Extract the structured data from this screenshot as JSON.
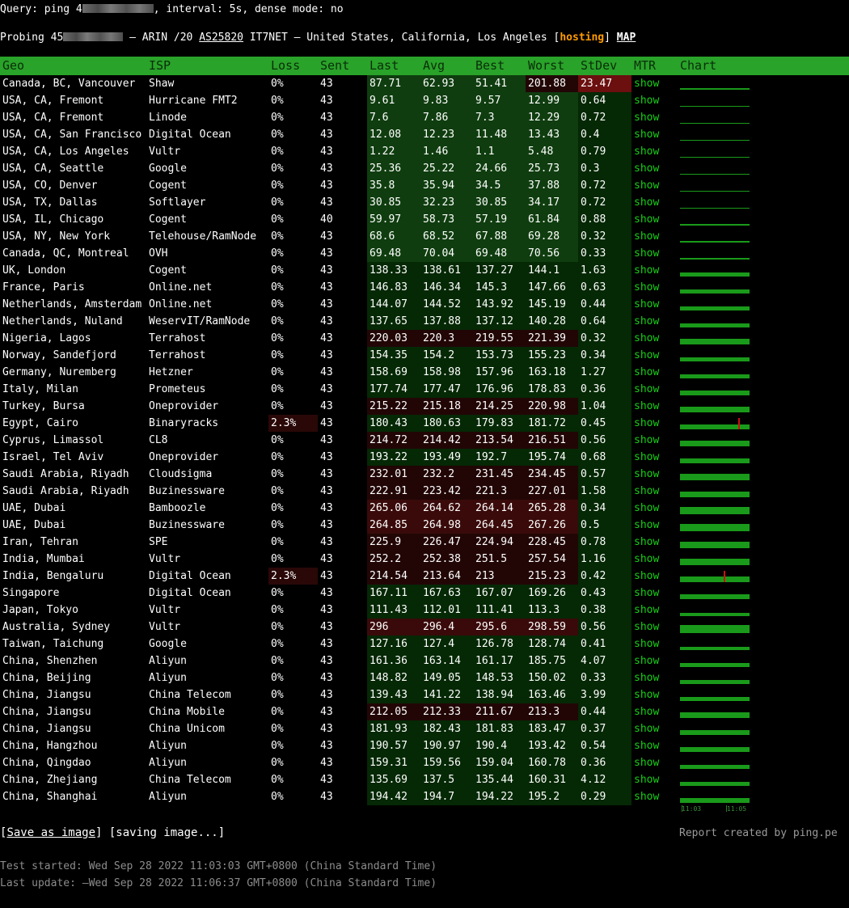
{
  "query": {
    "prefix": "Query: ping 4",
    "suffix": ", interval: 5s, dense mode: no"
  },
  "probing": {
    "prefix": "Probing 45",
    "rest_before": " — ARIN /20 ",
    "asn": "AS25820",
    "isp_loc": " IT7NET — United States, California, Los Angeles [",
    "hosting": "hosting",
    "close": "] ",
    "map": "MAP"
  },
  "table": {
    "headers": [
      "Geo",
      "ISP",
      "Loss",
      "Sent",
      "Last",
      "Avg",
      "Best",
      "Worst",
      "StDev",
      "MTR",
      "Chart"
    ],
    "mtr_label": "show",
    "rows": [
      [
        "Canada, BC, Vancouver",
        "Shaw",
        "0%",
        "43",
        "87.71",
        "62.93",
        "51.41",
        "201.88",
        "23.47"
      ],
      [
        "USA, CA, Fremont",
        "Hurricane FMT2",
        "0%",
        "43",
        "9.61",
        "9.83",
        "9.57",
        "12.99",
        "0.64"
      ],
      [
        "USA, CA, Fremont",
        "Linode",
        "0%",
        "43",
        "7.6",
        "7.86",
        "7.3",
        "12.29",
        "0.72"
      ],
      [
        "USA, CA, San Francisco",
        "Digital Ocean",
        "0%",
        "43",
        "12.08",
        "12.23",
        "11.48",
        "13.43",
        "0.4"
      ],
      [
        "USA, CA, Los Angeles",
        "Vultr",
        "0%",
        "43",
        "1.22",
        "1.46",
        "1.1",
        "5.48",
        "0.79"
      ],
      [
        "USA, CA, Seattle",
        "Google",
        "0%",
        "43",
        "25.36",
        "25.22",
        "24.66",
        "25.73",
        "0.3"
      ],
      [
        "USA, CO, Denver",
        "Cogent",
        "0%",
        "43",
        "35.8",
        "35.94",
        "34.5",
        "37.88",
        "0.72"
      ],
      [
        "USA, TX, Dallas",
        "Softlayer",
        "0%",
        "43",
        "30.85",
        "32.23",
        "30.85",
        "34.17",
        "0.72"
      ],
      [
        "USA, IL, Chicago",
        "Cogent",
        "0%",
        "40",
        "59.97",
        "58.73",
        "57.19",
        "61.84",
        "0.88"
      ],
      [
        "USA, NY, New York",
        "Telehouse/RamNode",
        "0%",
        "43",
        "68.6",
        "68.52",
        "67.88",
        "69.28",
        "0.32"
      ],
      [
        "Canada, QC, Montreal",
        "OVH",
        "0%",
        "43",
        "69.48",
        "70.04",
        "69.48",
        "70.56",
        "0.33"
      ],
      [
        "UK, London",
        "Cogent",
        "0%",
        "43",
        "138.33",
        "138.61",
        "137.27",
        "144.1",
        "1.63"
      ],
      [
        "France, Paris",
        "Online.net",
        "0%",
        "43",
        "146.83",
        "146.34",
        "145.3",
        "147.66",
        "0.63"
      ],
      [
        "Netherlands, Amsterdam",
        "Online.net",
        "0%",
        "43",
        "144.07",
        "144.52",
        "143.92",
        "145.19",
        "0.44"
      ],
      [
        "Netherlands, Nuland",
        "WeservIT/RamNode",
        "0%",
        "43",
        "137.65",
        "137.88",
        "137.12",
        "140.28",
        "0.64"
      ],
      [
        "Nigeria, Lagos",
        "Terrahost",
        "0%",
        "43",
        "220.03",
        "220.3",
        "219.55",
        "221.39",
        "0.32"
      ],
      [
        "Norway, Sandefjord",
        "Terrahost",
        "0%",
        "43",
        "154.35",
        "154.2",
        "153.73",
        "155.23",
        "0.34"
      ],
      [
        "Germany, Nuremberg",
        "Hetzner",
        "0%",
        "43",
        "158.69",
        "158.98",
        "157.96",
        "163.18",
        "1.27"
      ],
      [
        "Italy, Milan",
        "Prometeus",
        "0%",
        "43",
        "177.74",
        "177.47",
        "176.96",
        "178.83",
        "0.36"
      ],
      [
        "Turkey, Bursa",
        "Oneprovider",
        "0%",
        "43",
        "215.22",
        "215.18",
        "214.25",
        "220.98",
        "1.04"
      ],
      [
        "Egypt, Cairo",
        "Binaryracks",
        "2.3%",
        "43",
        "180.43",
        "180.63",
        "179.83",
        "181.72",
        "0.45"
      ],
      [
        "Cyprus, Limassol",
        "CL8",
        "0%",
        "43",
        "214.72",
        "214.42",
        "213.54",
        "216.51",
        "0.56"
      ],
      [
        "Israel, Tel Aviv",
        "Oneprovider",
        "0%",
        "43",
        "193.22",
        "193.49",
        "192.7",
        "195.74",
        "0.68"
      ],
      [
        "Saudi Arabia, Riyadh",
        "Cloudsigma",
        "0%",
        "43",
        "232.01",
        "232.2",
        "231.45",
        "234.45",
        "0.57"
      ],
      [
        "Saudi Arabia, Riyadh",
        "Buzinessware",
        "0%",
        "43",
        "222.91",
        "223.42",
        "221.3",
        "227.01",
        "1.58"
      ],
      [
        "UAE, Dubai",
        "Bamboozle",
        "0%",
        "43",
        "265.06",
        "264.62",
        "264.14",
        "265.28",
        "0.34"
      ],
      [
        "UAE, Dubai",
        "Buzinessware",
        "0%",
        "43",
        "264.85",
        "264.98",
        "264.45",
        "267.26",
        "0.5"
      ],
      [
        "Iran, Tehran",
        "SPE",
        "0%",
        "43",
        "225.9",
        "226.47",
        "224.94",
        "228.45",
        "0.78"
      ],
      [
        "India, Mumbai",
        "Vultr",
        "0%",
        "43",
        "252.2",
        "252.38",
        "251.5",
        "257.54",
        "1.16"
      ],
      [
        "India, Bengaluru",
        "Digital Ocean",
        "2.3%",
        "43",
        "214.54",
        "213.64",
        "213",
        "215.23",
        "0.42"
      ],
      [
        "Singapore",
        "Digital Ocean",
        "0%",
        "43",
        "167.11",
        "167.63",
        "167.07",
        "169.26",
        "0.43"
      ],
      [
        "Japan, Tokyo",
        "Vultr",
        "0%",
        "43",
        "111.43",
        "112.01",
        "111.41",
        "113.3",
        "0.38"
      ],
      [
        "Australia, Sydney",
        "Vultr",
        "0%",
        "43",
        "296",
        "296.4",
        "295.6",
        "298.59",
        "0.56"
      ],
      [
        "Taiwan, Taichung",
        "Google",
        "0%",
        "43",
        "127.16",
        "127.4",
        "126.78",
        "128.74",
        "0.41"
      ],
      [
        "China, Shenzhen",
        "Aliyun",
        "0%",
        "43",
        "161.36",
        "163.14",
        "161.17",
        "185.75",
        "4.07"
      ],
      [
        "China, Beijing",
        "Aliyun",
        "0%",
        "43",
        "148.82",
        "149.05",
        "148.53",
        "150.02",
        "0.33"
      ],
      [
        "China, Jiangsu",
        "China Telecom",
        "0%",
        "43",
        "139.43",
        "141.22",
        "138.94",
        "163.46",
        "3.99"
      ],
      [
        "China, Jiangsu",
        "China Mobile",
        "0%",
        "43",
        "212.05",
        "212.33",
        "211.67",
        "213.3",
        "0.44"
      ],
      [
        "China, Jiangsu",
        "China Unicom",
        "0%",
        "43",
        "181.93",
        "182.43",
        "181.83",
        "183.47",
        "0.37"
      ],
      [
        "China, Hangzhou",
        "Aliyun",
        "0%",
        "43",
        "190.57",
        "190.97",
        "190.4",
        "193.42",
        "0.54"
      ],
      [
        "China, Qingdao",
        "Aliyun",
        "0%",
        "43",
        "159.31",
        "159.56",
        "159.04",
        "160.78",
        "0.36"
      ],
      [
        "China, Zhejiang",
        "China Telecom",
        "0%",
        "43",
        "135.69",
        "137.5",
        "135.44",
        "160.31",
        "4.12"
      ],
      [
        "China, Shanghai",
        "Aliyun",
        "0%",
        "43",
        "194.42",
        "194.7",
        "194.22",
        "195.2",
        "0.29"
      ]
    ]
  },
  "chart_axis": {
    "start": "11:03",
    "end": "11:05"
  },
  "footer": {
    "save_open": "[",
    "save_link": "Save as image",
    "save_close": "] [saving image...]",
    "report": "Report created by ping.pe",
    "started": "Test started: Wed Sep 28 2022 11:03:03 GMT+0800 (China Standard Time)",
    "updated": "Last update: —Wed Sep 28 2022 11:06:37 GMT+0800 (China Standard Time)"
  },
  "colors": {
    "header_bg": "#29a329",
    "green_cell": "#0f3d0f",
    "red_cell": "#3a0a0a",
    "mtr_link": "#17d017",
    "hosting": "#ff9c00"
  }
}
